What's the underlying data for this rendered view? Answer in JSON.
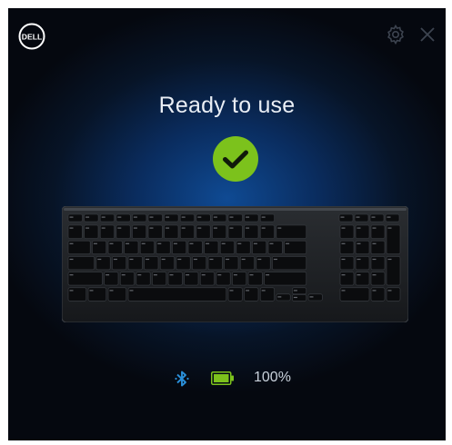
{
  "app": {
    "brand": "DELL",
    "title": "Ready to use"
  },
  "icons": {
    "logo": "dell-logo",
    "settings": "gear-icon",
    "close": "close-icon",
    "status": "check-circle-icon",
    "bluetooth": "bluetooth-icon",
    "battery": "battery-icon"
  },
  "device": {
    "image": "wireless-keyboard"
  },
  "status_bar": {
    "battery_level": "100%",
    "battery_fraction": 1.0
  },
  "colors": {
    "accent_green": "#7cc21c",
    "bluetooth_blue": "#2a8fd9",
    "background": "#061226"
  }
}
